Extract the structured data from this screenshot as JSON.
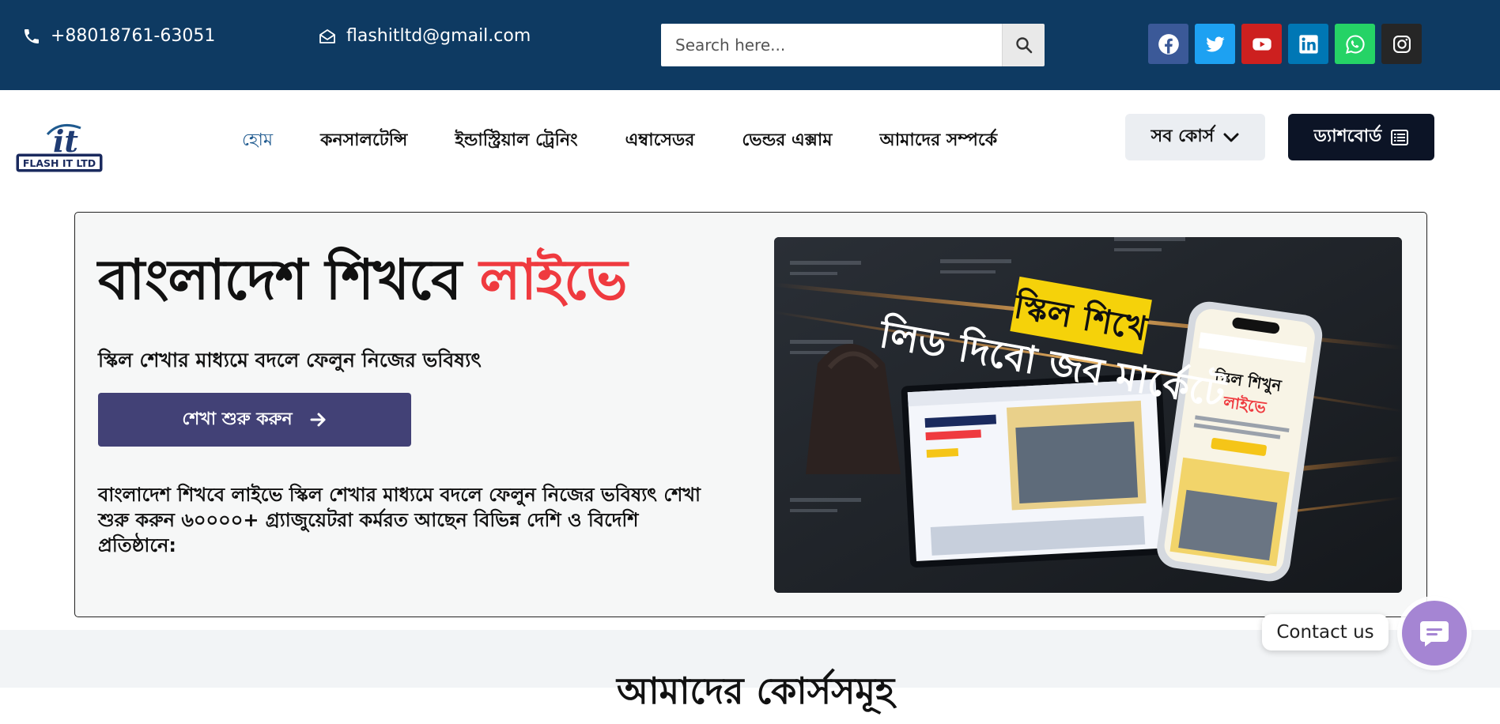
{
  "topbar": {
    "phone": "+88018761-63051",
    "email": "flashitltd@gmail.com",
    "search": {
      "placeholder": "Search here..."
    },
    "socials": [
      {
        "icon": "facebook-icon",
        "color": "#3b5998"
      },
      {
        "icon": "twitter-icon",
        "color": "#1da1f2"
      },
      {
        "icon": "youtube-icon",
        "color": "#cd201f"
      },
      {
        "icon": "linkedin-icon",
        "color": "#0077b5"
      },
      {
        "icon": "whatsapp-icon",
        "color": "#25d366"
      },
      {
        "icon": "instagram-icon",
        "color": "#262626"
      }
    ]
  },
  "logo": {
    "line1": "it",
    "line2": "FLASH IT LTD"
  },
  "nav": {
    "items": [
      "হোম",
      "কনসালটেন্সি",
      "ইন্ডাস্ট্রিয়াল ট্রেনিং",
      "এম্বাসেডর",
      "ভেন্ডর এক্সাম",
      "আমাদের সম্পর্কে"
    ],
    "courses_label": "সব কোর্স",
    "dashboard_label": "ড্যাশবোর্ড"
  },
  "hero": {
    "title_main": "বাংলাদেশ শিখবে ",
    "title_accent": "লাইভে",
    "subtitle": "স্কিল শেখার মাধ্যমে বদলে ফেলুন নিজের ভবিষ্যৎ",
    "cta_label": "শেখা শুরু করুন",
    "description": "বাংলাদেশ শিখবে লাইভে স্কিল শেখার মাধ্যমে বদলে ফেলুন নিজের ভবিষ্যৎ শেখা শুরু করুন ৬০০০০+ গ্র্যাজুয়েটরা কর্মরত আছেন বিভিন্ন দেশি ও বিদেশি প্রতিষ্ঠানে:",
    "image_text": {
      "headline_badge": "স্কিল শিখে",
      "headline": "লিড দিবো জব মার্কেটে",
      "phone_title": "স্কিল শিখুন",
      "phone_accent": "লাইভে"
    }
  },
  "section_heading": "আমাদের কোর্সসমূহ",
  "contact": {
    "label": "Contact us"
  },
  "colors": {
    "topbar": "#0e3a62",
    "accent_red": "#ef3a3f",
    "cta": "#424176",
    "dashboard": "#0c1426",
    "contact": "#a585d3"
  }
}
